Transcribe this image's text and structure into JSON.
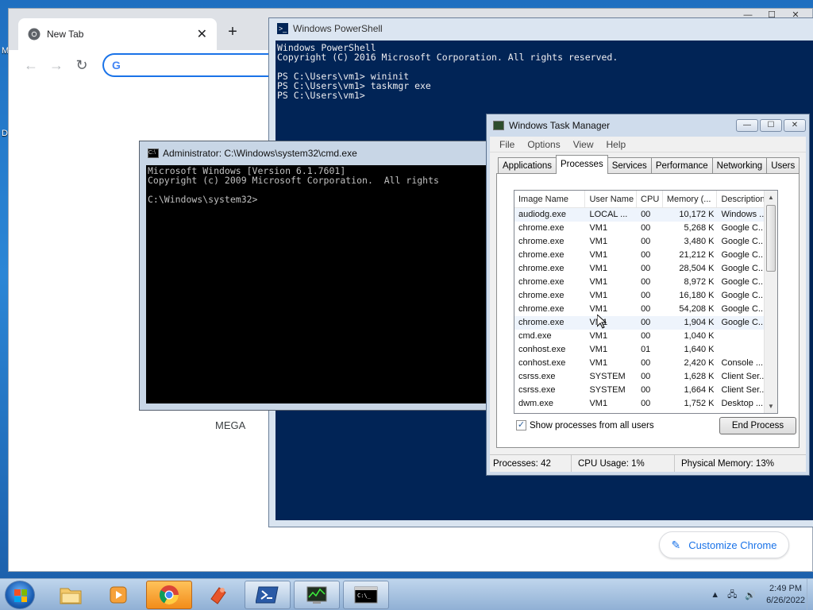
{
  "desktop": {
    "edge_labels": [
      "M",
      "D"
    ]
  },
  "chrome": {
    "tab_title": "New Tab",
    "tab_close": "✕",
    "new_tab": "+",
    "omnibox_value": "",
    "shortcut_label": "MEGA",
    "customize_label": "Customize Chrome"
  },
  "powershell": {
    "title": "Windows PowerShell",
    "lines": "Windows PowerShell\nCopyright (C) 2016 Microsoft Corporation. All rights reserved.\n\nPS C:\\Users\\vm1> wininit\nPS C:\\Users\\vm1> taskmgr exe\nPS C:\\Users\\vm1>"
  },
  "cmd": {
    "title": "Administrator: C:\\Windows\\system32\\cmd.exe",
    "lines": "Microsoft Windows [Version 6.1.7601]\nCopyright (c) 2009 Microsoft Corporation.  All rights\n\nC:\\Windows\\system32>"
  },
  "taskmgr": {
    "title": "Windows Task Manager",
    "menu": [
      "File",
      "Options",
      "View",
      "Help"
    ],
    "tabs": [
      "Applications",
      "Processes",
      "Services",
      "Performance",
      "Networking",
      "Users"
    ],
    "columns": [
      "Image Name",
      "User Name",
      "CPU",
      "Memory (...",
      "Description"
    ],
    "rows": [
      [
        "audiodg.exe",
        "LOCAL ...",
        "00",
        "10,172 K",
        "Windows ..."
      ],
      [
        "chrome.exe",
        "VM1",
        "00",
        "5,268 K",
        "Google C..."
      ],
      [
        "chrome.exe",
        "VM1",
        "00",
        "3,480 K",
        "Google C..."
      ],
      [
        "chrome.exe",
        "VM1",
        "00",
        "21,212 K",
        "Google C..."
      ],
      [
        "chrome.exe",
        "VM1",
        "00",
        "28,504 K",
        "Google C..."
      ],
      [
        "chrome.exe",
        "VM1",
        "00",
        "8,972 K",
        "Google C..."
      ],
      [
        "chrome.exe",
        "VM1",
        "00",
        "16,180 K",
        "Google C..."
      ],
      [
        "chrome.exe",
        "VM1",
        "00",
        "54,208 K",
        "Google C..."
      ],
      [
        "chrome.exe",
        "VM1",
        "00",
        "1,904 K",
        "Google C..."
      ],
      [
        "cmd.exe",
        "VM1",
        "00",
        "1,040 K",
        ""
      ],
      [
        "conhost.exe",
        "VM1",
        "01",
        "1,640 K",
        ""
      ],
      [
        "conhost.exe",
        "VM1",
        "00",
        "2,420 K",
        "Console ..."
      ],
      [
        "csrss.exe",
        "SYSTEM",
        "00",
        "1,628 K",
        "Client Ser..."
      ],
      [
        "csrss.exe",
        "SYSTEM",
        "00",
        "1,664 K",
        "Client Ser..."
      ],
      [
        "dwm.exe",
        "VM1",
        "00",
        "1,752 K",
        "Desktop ..."
      ]
    ],
    "show_all_label": "Show processes from all users",
    "end_process_label": "End Process",
    "status": {
      "processes": "Processes: 42",
      "cpu": "CPU Usage: 1%",
      "memory": "Physical Memory: 13%"
    }
  },
  "taskbar": {
    "time": "2:49 PM",
    "date": "6/26/2022"
  }
}
